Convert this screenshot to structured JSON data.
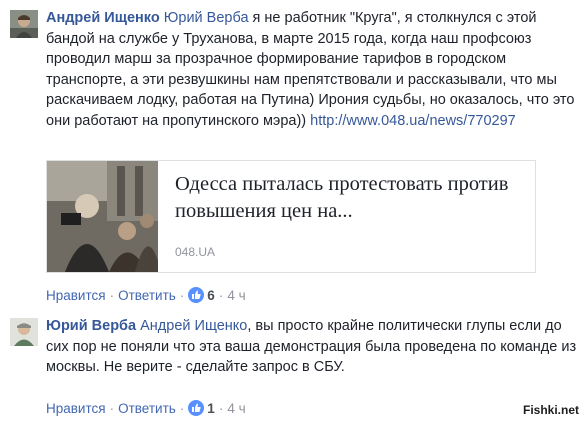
{
  "comment1": {
    "author": "Андрей Ищенко",
    "mention": "Юрий Верба",
    "text": " я не работник \"Круга\", я столкнулся с этой бандой на службе у Труханова, в марте 2015 года, когда наш профсоюз проводил марш за прозрачное формирование тарифов в городском транспорте, а эти резвушкины нам препятствовали и рассказывали, что мы раскачиваем лодку, работая на Путина) Ирония судьбы, но оказалось, что это они работают на пропутинского мэра)) ",
    "link": "http://www.048.ua/news/770297",
    "preview": {
      "title": "Одесса пыталась протестовать против повышения цен на...",
      "domain": "048.UA"
    },
    "actions": {
      "like": "Нравится",
      "reply": "Ответить",
      "like_count": "6",
      "time": "4 ч"
    },
    "avatar_icon": "user-avatar"
  },
  "comment2": {
    "author": "Юрий Верба",
    "mention": "Андрей Ищенко",
    "text": ", вы просто крайне политически глупы если до сих пор не поняли что эта ваша демонстрация была проведена по команде из москвы. Не верите - сделайте запрос в СБУ.",
    "actions": {
      "like": "Нравится",
      "reply": "Ответить",
      "like_count": "1",
      "time": "4 ч"
    },
    "avatar_icon": "user-avatar"
  },
  "watermark": "Fishki.net",
  "colors": {
    "link": "#365899",
    "action": "#4267b2",
    "meta": "#90949c",
    "like_badge": "#5890ff"
  }
}
